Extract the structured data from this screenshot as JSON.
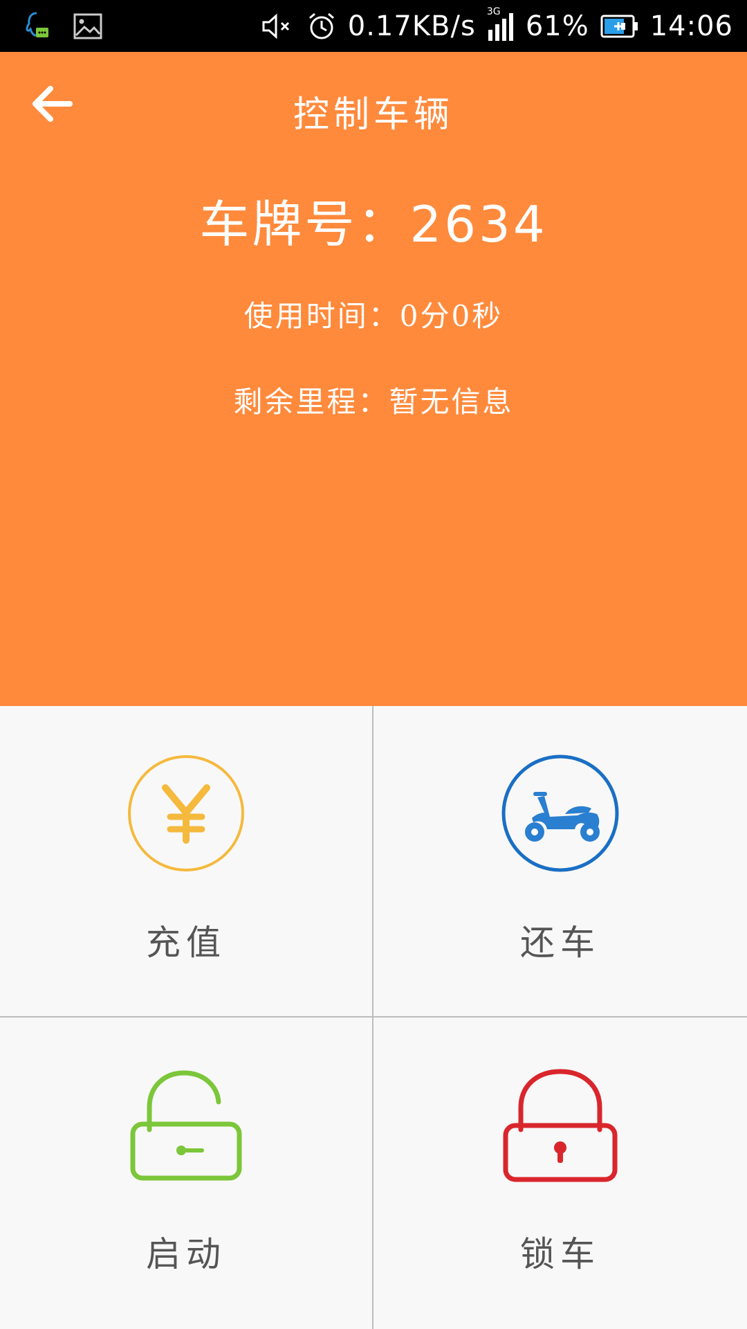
{
  "status_bar": {
    "net_speed": "0.17KB/s",
    "network_type": "3G",
    "battery": "61%",
    "time": "14:06",
    "icons": [
      "qq-notification-icon",
      "image-notification-icon",
      "mute-icon",
      "alarm-icon",
      "signal-icon",
      "battery-charging-icon"
    ]
  },
  "header": {
    "title": "控制车辆",
    "plate_label": "车牌号：",
    "plate_number": "2634",
    "usage_time": "使用时间：0分0秒",
    "remaining_range": "剩余里程：暂无信息",
    "background_color": "#ff8a3c"
  },
  "actions": {
    "recharge": {
      "label": "充值",
      "icon": "yen-icon",
      "color": "#f5b93d"
    },
    "return_vehicle": {
      "label": "还车",
      "icon": "scooter-icon",
      "color": "#1a6fc4"
    },
    "start": {
      "label": "启动",
      "icon": "unlock-icon",
      "color": "#7cc63a"
    },
    "lock": {
      "label": "锁车",
      "icon": "lock-icon",
      "color": "#d9262c"
    }
  }
}
